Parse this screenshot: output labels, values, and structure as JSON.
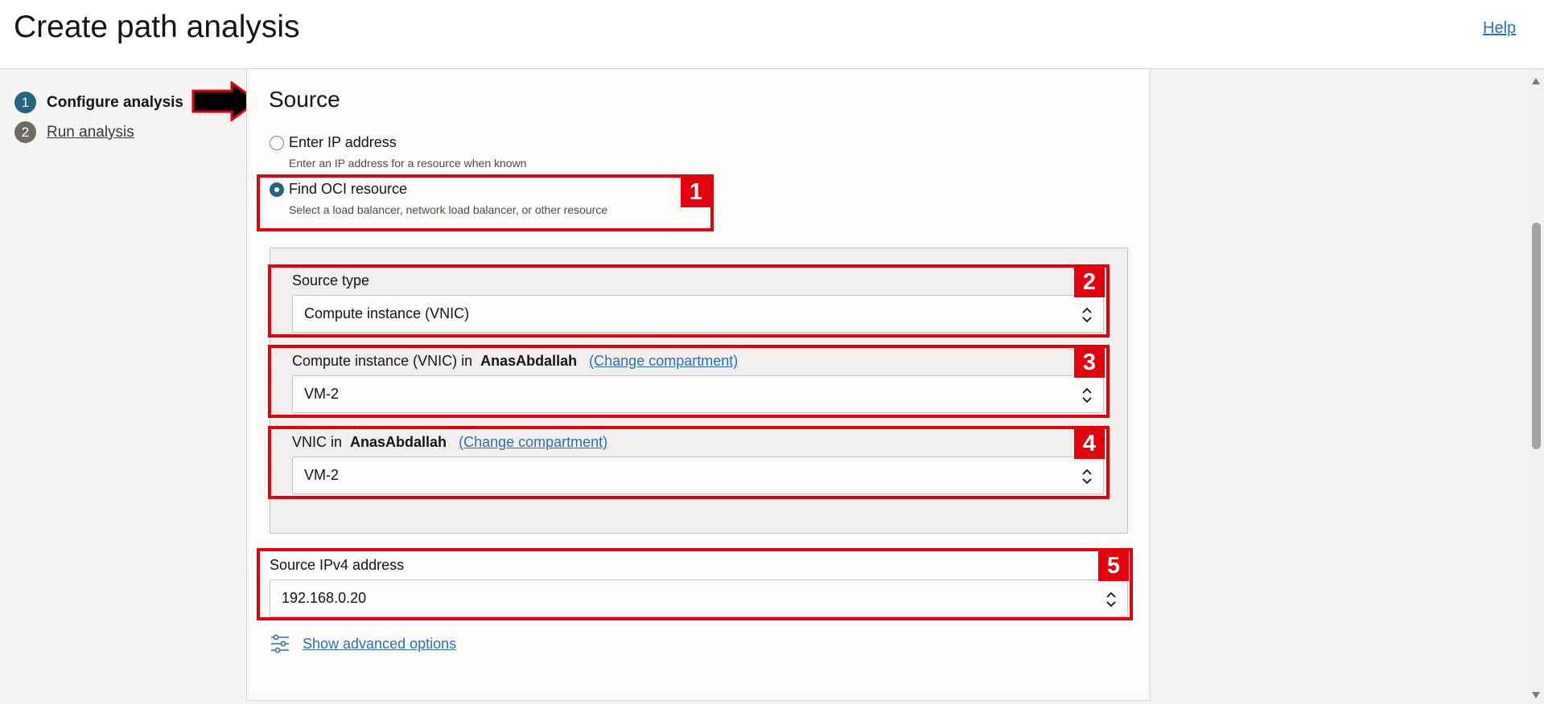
{
  "header": {
    "title": "Create path analysis",
    "help_label": "Help"
  },
  "steps": [
    {
      "number": "1",
      "label": "Configure analysis",
      "active": true
    },
    {
      "number": "2",
      "label": "Run analysis",
      "active": false
    }
  ],
  "source": {
    "title": "Source",
    "options": [
      {
        "label": "Enter IP address",
        "description": "Enter an IP address for a resource when known",
        "selected": false
      },
      {
        "label": "Find OCI resource",
        "description": "Select a load balancer, network load balancer, or other resource",
        "selected": true
      }
    ],
    "source_type": {
      "label": "Source type",
      "value": "Compute instance (VNIC)"
    },
    "compute_instance": {
      "label_prefix": "Compute instance (VNIC) in",
      "compartment": "AnasAbdallah",
      "change_link": "(Change compartment)",
      "value": "VM-2"
    },
    "vnic": {
      "label_prefix": "VNIC in",
      "compartment": "AnasAbdallah",
      "change_link": "(Change compartment)",
      "value": "VM-2"
    },
    "ipv4": {
      "label": "Source IPv4 address",
      "value": "192.168.0.20"
    },
    "advanced_link": "Show advanced options"
  },
  "annotations": [
    "1",
    "2",
    "3",
    "4",
    "5"
  ],
  "colors": {
    "annotation_red": "#e3000f",
    "step_active": "#26647f",
    "link": "#2f6eb5"
  }
}
